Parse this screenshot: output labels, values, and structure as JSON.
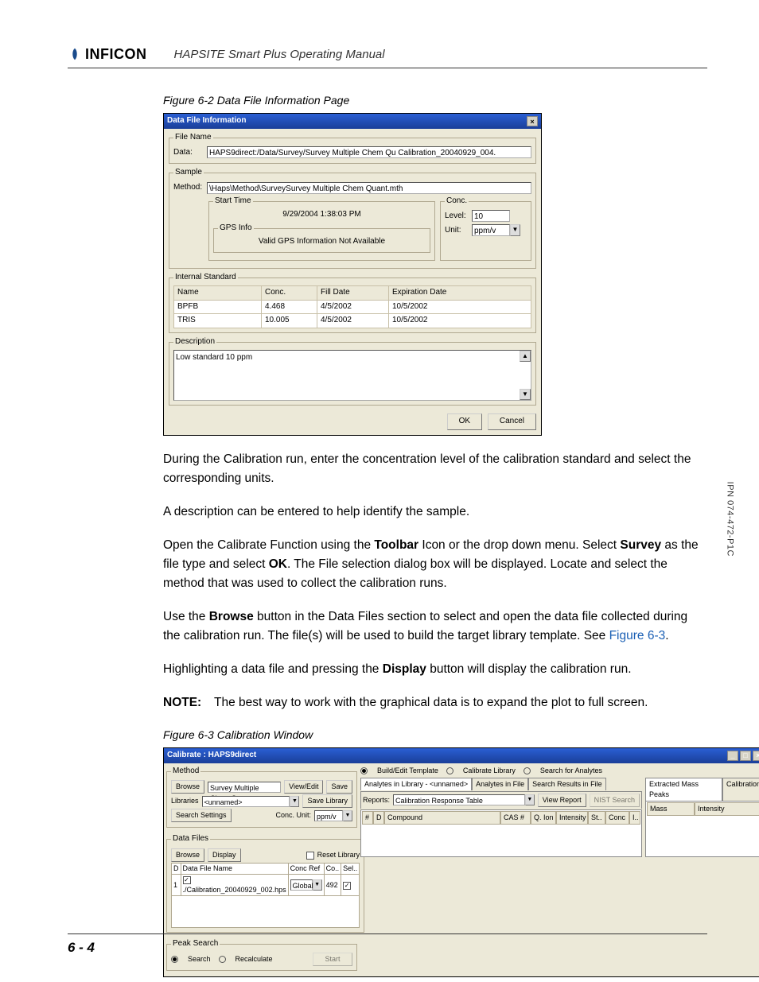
{
  "header": {
    "brand": "INFICON",
    "manual_title": "HAPSITE Smart Plus Operating Manual"
  },
  "side_code": "IPN 074-472-P1C",
  "page_number": "6 - 4",
  "figure1": {
    "caption": "Figure 6-2  Data File Information Page",
    "dialog_title": "Data File Information",
    "file_name_legend": "File Name",
    "data_label": "Data:",
    "data_path": "HAPS9direct:/Data/Survey/Survey Multiple Chem Qu Calibration_20040929_004.",
    "sample_legend": "Sample",
    "method_label": "Method:",
    "method_path": "\\Haps\\Method\\SurveySurvey Multiple Chem Quant.mth",
    "start_time_legend": "Start Time",
    "start_time_value": "9/29/2004 1:38:03 PM",
    "gps_legend": "GPS Info",
    "gps_value": "Valid GPS Information Not Available",
    "conc_legend": "Conc.",
    "level_label": "Level:",
    "level_value": "10",
    "unit_label": "Unit:",
    "unit_value": "ppm/v",
    "internal_std_legend": "Internal Standard",
    "table": {
      "headers": [
        "Name",
        "Conc.",
        "Fill Date",
        "Expiration Date"
      ],
      "rows": [
        [
          "BPFB",
          "4.468",
          "4/5/2002",
          "10/5/2002"
        ],
        [
          "TRIS",
          "10.005",
          "4/5/2002",
          "10/5/2002"
        ]
      ]
    },
    "description_legend": "Description",
    "description_text": "Low standard  10 ppm",
    "ok": "OK",
    "cancel": "Cancel"
  },
  "paragraphs": {
    "p1": "During the Calibration run, enter the concentration level of the calibration standard and select the corresponding units.",
    "p2": "A description can be entered to help identify the sample.",
    "p3a": "Open the Calibrate Function using the ",
    "p3b": "Toolbar",
    "p3c": " Icon or the drop down menu. Select ",
    "p3d": "Survey",
    "p3e": " as the file type and select ",
    "p3f": "OK",
    "p3g": ". The File selection dialog box will be displayed. Locate and select the method that was used to collect the calibration runs.",
    "p4a": "Use the ",
    "p4b": "Browse",
    "p4c": " button in the Data Files section to select and open the data file collected during the calibration run. The file(s) will be used to build the target library template. See ",
    "p4link": "Figure 6-3",
    "p4d": ".",
    "p5a": "Highlighting a data file and pressing the ",
    "p5b": "Display",
    "p5c": " button will display the calibration run.",
    "note_label": "NOTE:",
    "note_text": "The best way to work with the graphical data is to expand the plot to full screen."
  },
  "figure2": {
    "caption": "Figure 6-3  Calibration Window",
    "dialog_title": "Calibrate : HAPS9direct",
    "method_legend": "Method",
    "browse": "Browse",
    "method_name": "Survey Multiple Chem Qua",
    "view_edit": "View/Edit",
    "save": "Save",
    "libraries_label": "Libraries",
    "libraries_value": "<unnamed>",
    "save_library": "Save Library",
    "search_settings": "Search Settings",
    "conc_unit_label": "Conc. Unit:",
    "conc_unit_value": "ppm/v",
    "data_files_legend": "Data Files",
    "display": "Display",
    "reset_library_label": "Reset Library",
    "df_headers": [
      "D",
      "Data File Name",
      "Conc Ref",
      "Co..",
      "Sel.."
    ],
    "df_row": [
      "1",
      "✓",
      "./Calibration_20040929_002.hps",
      "Global",
      "492",
      "✓"
    ],
    "peak_search_legend": "Peak Search",
    "search_opt": "Search",
    "recalc_opt": "Recalculate",
    "start": "Start",
    "mode_build": "Build/Edit Template",
    "mode_calib": "Calibrate Library",
    "mode_search": "Search for Analytes",
    "tabs": [
      "Analytes in Library - <unnamed>",
      "Analytes in File",
      "Search Results in File"
    ],
    "reports_label": "Reports:",
    "reports_value": "Calibration Response Table",
    "view_report": "View Report",
    "nist_search": "NIST Search",
    "report_headers": [
      "#",
      "D",
      "Compound",
      "CAS #",
      "Q. Ion",
      "Intensity",
      "St..",
      "Conc",
      "I.."
    ],
    "right_tabs": [
      "Extracted Mass Peaks",
      "Calibration"
    ],
    "mass_header": "Mass",
    "intensity_header": "Intensity"
  }
}
